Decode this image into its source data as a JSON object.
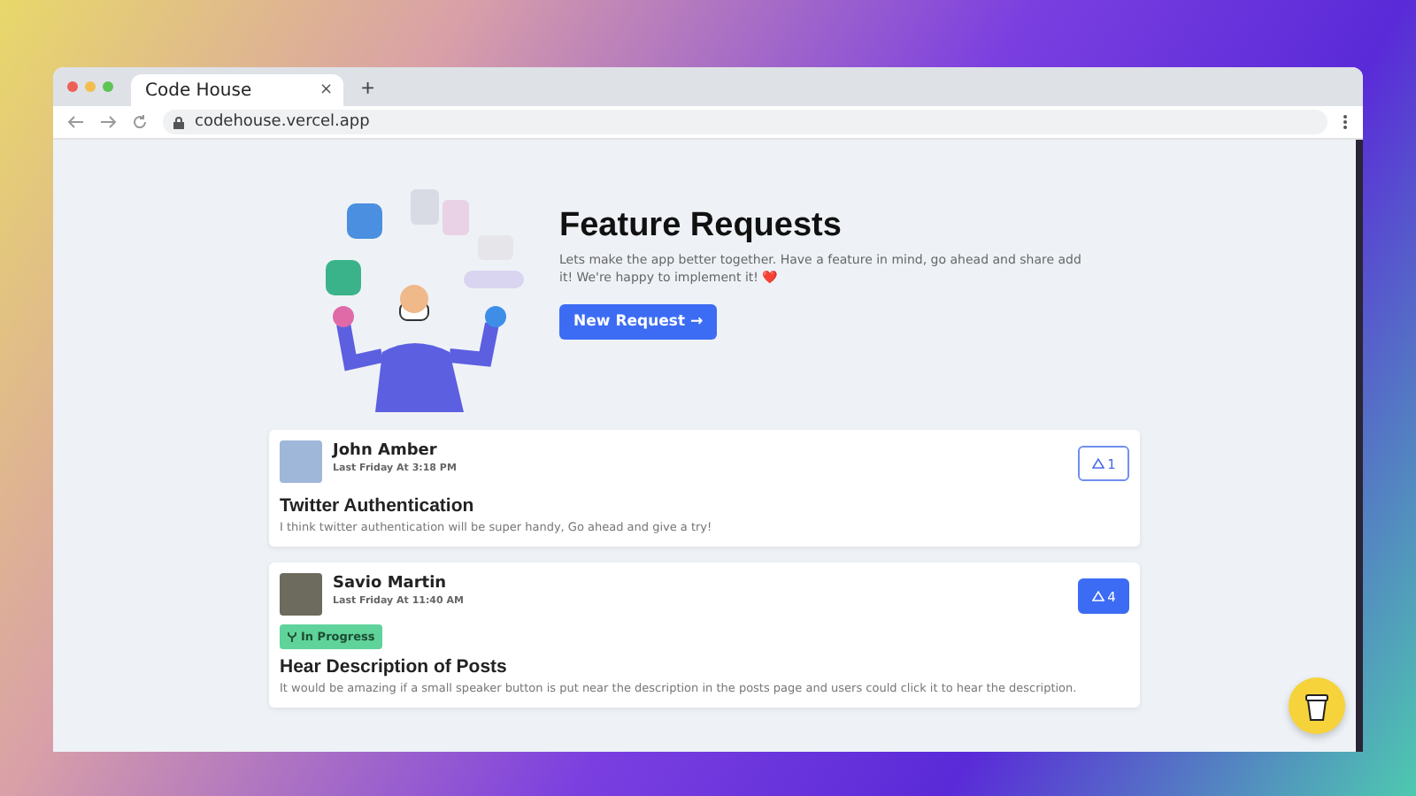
{
  "browser": {
    "tab_title": "Code House",
    "tab_close": "×",
    "new_tab": "+",
    "url": "codehouse.vercel.app"
  },
  "hero": {
    "title": "Feature Requests",
    "description": "Lets make the app better together. Have a feature in mind, go ahead and share add it! We're happy to implement it! ❤️",
    "button": "New Request →"
  },
  "posts": [
    {
      "author": "John Amber",
      "time": "Last Friday At 3:18 PM",
      "votes": "1",
      "voted": false,
      "title": "Twitter Authentication",
      "body": "I think twitter authentication will be super handy, Go ahead and give a try!"
    },
    {
      "author": "Savio Martin",
      "time": "Last Friday At 11:40 AM",
      "votes": "4",
      "voted": true,
      "status": {
        "label": "In Progress",
        "color": "#5fd39a"
      },
      "title": "Hear Description of Posts",
      "body": "It would be amazing if a small speaker button is put near the description in the posts page and users could click it to hear the description."
    }
  ]
}
